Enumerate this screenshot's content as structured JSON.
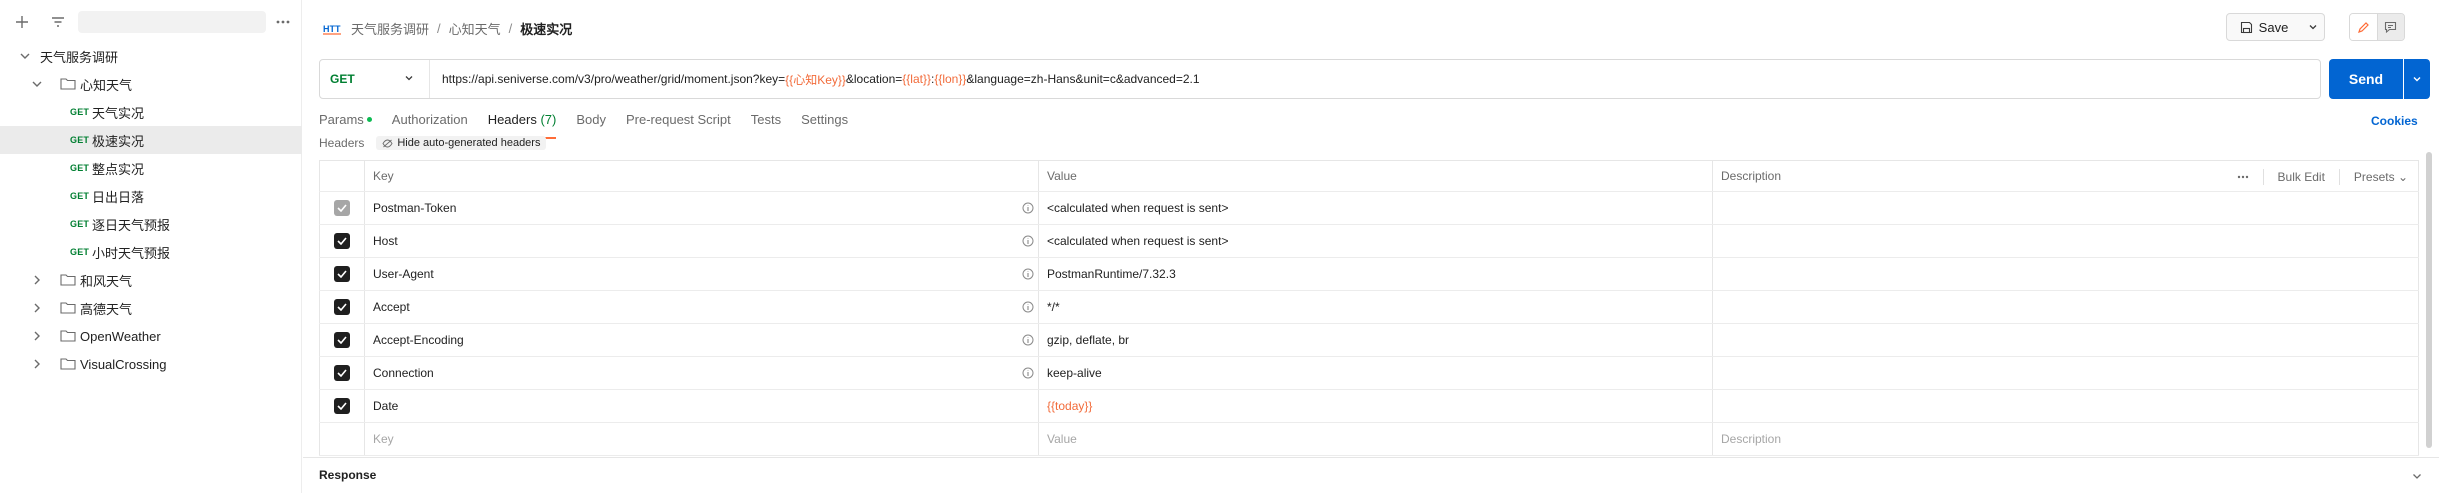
{
  "sidebar": {
    "toolbar": {
      "add_icon": "plus-icon",
      "filter_icon": "filter-icon",
      "more_icon": "more-horizontal-icon"
    },
    "tree": [
      {
        "label": "天气服务调研",
        "type": "collection",
        "expanded": true
      },
      {
        "label": "心知天气",
        "type": "folder",
        "expanded": true
      },
      {
        "method": "GET",
        "label": "天气实况",
        "type": "request"
      },
      {
        "method": "GET",
        "label": "极速实况",
        "type": "request",
        "active": true
      },
      {
        "method": "GET",
        "label": "整点实况",
        "type": "request"
      },
      {
        "method": "GET",
        "label": "日出日落",
        "type": "request"
      },
      {
        "method": "GET",
        "label": "逐日天气预报",
        "type": "request"
      },
      {
        "method": "GET",
        "label": "小时天气预报",
        "type": "request"
      },
      {
        "label": "和风天气",
        "type": "folder",
        "expanded": false
      },
      {
        "label": "高德天气",
        "type": "folder",
        "expanded": false
      },
      {
        "label": "OpenWeather",
        "type": "folder",
        "expanded": false
      },
      {
        "label": "VisualCrossing",
        "type": "folder",
        "expanded": false
      }
    ]
  },
  "header": {
    "breadcrumb": [
      "天气服务调研",
      "心知天气"
    ],
    "breadcrumb_sep": "/",
    "current": "极速实况",
    "save_label": "Save"
  },
  "request": {
    "method": "GET",
    "url_parts": [
      {
        "text": "https://api.seniverse.com/v3/pro/weather/grid/moment.json?key=",
        "var": false
      },
      {
        "text": "{{心知Key}}",
        "var": true
      },
      {
        "text": "&location=",
        "var": false
      },
      {
        "text": "{{lat}}",
        "var": true
      },
      {
        "text": ":",
        "var": false
      },
      {
        "text": "{{lon}}",
        "var": true
      },
      {
        "text": "&language=zh-Hans&unit=c&advanced=2.1",
        "var": false
      }
    ],
    "send_label": "Send"
  },
  "tabs": {
    "params": "Params",
    "authorization": "Authorization",
    "headers": "Headers",
    "headers_count": "(7)",
    "body": "Body",
    "prerequest": "Pre-request Script",
    "tests": "Tests",
    "settings": "Settings",
    "cookies": "Cookies"
  },
  "headers_section": {
    "label": "Headers",
    "hide_auto": "Hide auto-generated headers"
  },
  "table": {
    "columns": {
      "key": "Key",
      "value": "Value",
      "description": "Description"
    },
    "actions": {
      "bulk_edit": "Bulk Edit",
      "presets": "Presets"
    },
    "rows": [
      {
        "key": "Postman-Token",
        "value": "<calculated when request is sent>",
        "info": true,
        "checked": true,
        "disabled": true
      },
      {
        "key": "Host",
        "value": "<calculated when request is sent>",
        "info": true,
        "checked": true
      },
      {
        "key": "User-Agent",
        "value": "PostmanRuntime/7.32.3",
        "info": true,
        "checked": true
      },
      {
        "key": "Accept",
        "value": "*/*",
        "info": true,
        "checked": true
      },
      {
        "key": "Accept-Encoding",
        "value": "gzip, deflate, br",
        "info": true,
        "checked": true
      },
      {
        "key": "Connection",
        "value": "keep-alive",
        "info": true,
        "checked": true
      },
      {
        "key": "Date",
        "value": "{{today}}",
        "info": false,
        "checked": true,
        "var": true
      }
    ],
    "placeholders": {
      "key": "Key",
      "value": "Value",
      "description": "Description"
    }
  },
  "response": {
    "label": "Response"
  },
  "colors": {
    "accent": "#ff6c37",
    "send": "#0265d2",
    "get": "#007f31",
    "variable": "#f26b3a"
  }
}
